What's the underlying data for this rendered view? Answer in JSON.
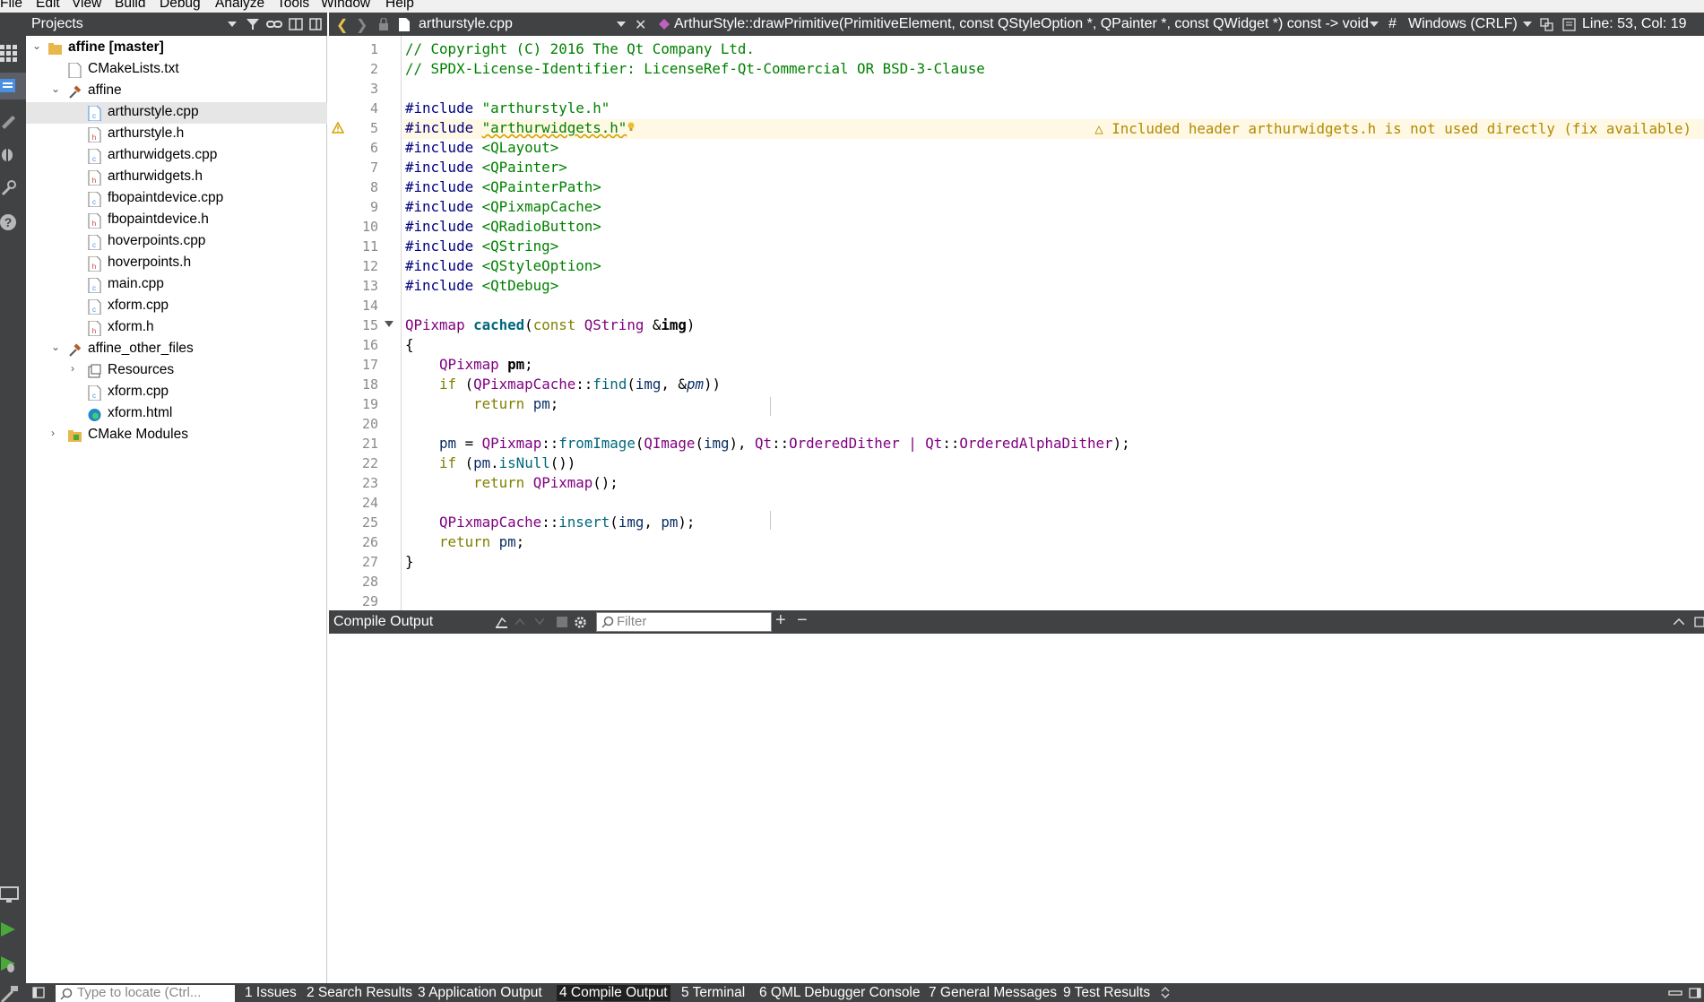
{
  "menu": [
    "File",
    "Edit",
    "View",
    "Build",
    "Debug",
    "Analyze",
    "Tools",
    "Window",
    "Help"
  ],
  "projects": {
    "title": "Projects",
    "tree": [
      {
        "label": "affine [master]",
        "bold": true
      },
      {
        "label": "CMakeLists.txt"
      },
      {
        "label": "affine"
      },
      {
        "label": "arthurstyle.cpp"
      },
      {
        "label": "arthurstyle.h"
      },
      {
        "label": "arthurwidgets.cpp"
      },
      {
        "label": "arthurwidgets.h"
      },
      {
        "label": "fbopaintdevice.cpp"
      },
      {
        "label": "fbopaintdevice.h"
      },
      {
        "label": "hoverpoints.cpp"
      },
      {
        "label": "hoverpoints.h"
      },
      {
        "label": "main.cpp"
      },
      {
        "label": "xform.cpp"
      },
      {
        "label": "xform.h"
      },
      {
        "label": "affine_other_files"
      },
      {
        "label": "Resources"
      },
      {
        "label": "xform.cpp"
      },
      {
        "label": "xform.html"
      },
      {
        "label": "CMake Modules"
      }
    ]
  },
  "editor": {
    "file_name": "arthurstyle.cpp",
    "symbol": "ArthurStyle::drawPrimitive(PrimitiveElement, const QStyleOption *, QPainter *, const QWidget *) const -> void",
    "hash": "#",
    "line_endings": "Windows (CRLF)",
    "position": "Line: 53, Col: 19",
    "warning": "Included header arthurwidgets.h is not used directly (fix available)",
    "line_numbers": [
      "1",
      "2",
      "3",
      "4",
      "5",
      "6",
      "7",
      "8",
      "9",
      "10",
      "11",
      "12",
      "13",
      "14",
      "15",
      "16",
      "17",
      "18",
      "19",
      "20",
      "21",
      "22",
      "23",
      "24",
      "25",
      "26",
      "27",
      "28",
      "29"
    ],
    "code": {
      "l1": "// Copyright (C) 2016 The Qt Company Ltd.",
      "l2": "// SPDX-License-Identifier: LicenseRef-Qt-Commercial OR BSD-3-Clause",
      "include": "#include",
      "l4_hdr": "\"arthurstyle.h\"",
      "l5_hdr": "\"arthurwidgets.h\"",
      "l6_hdr": "<QLayout>",
      "l7_hdr": "<QPainter>",
      "l8_hdr": "<QPainterPath>",
      "l9_hdr": "<QPixmapCache>",
      "l10_hdr": "<QRadioButton>",
      "l11_hdr": "<QString>",
      "l12_hdr": "<QStyleOption>",
      "l13_hdr": "<QtDebug>",
      "qpixmap": "QPixmap",
      "cached": "cached",
      "const": "const",
      "qstring": "QString",
      "img": "img",
      "pm": "pm",
      "if": "if",
      "return": "return",
      "qpixmapcache": "QPixmapCache",
      "find": "find",
      "fromimage": "fromImage",
      "qimage": "QImage",
      "qt": "Qt",
      "ordereddither": "OrderedDither",
      "orderedalphadither": "OrderedAlphaDither",
      "isnull": "isNull",
      "insert": "insert"
    }
  },
  "output": {
    "title": "Compile Output",
    "filter_placeholder": "Filter"
  },
  "statusbar": {
    "locator_placeholder": "Type to locate (Ctrl...",
    "tabs": [
      "1  Issues",
      "2  Search Results",
      "3  Application Output",
      "4  Compile Output",
      "5  Terminal",
      "6  QML Debugger Console",
      "7  General Messages",
      "9  Test Results"
    ],
    "active_tab": "4  Compile Output"
  },
  "colors": {
    "panel": "#404244",
    "selected_row": "#e6e6e6",
    "warning_line": "#fff8e4",
    "run_green": "#4aa83a"
  }
}
